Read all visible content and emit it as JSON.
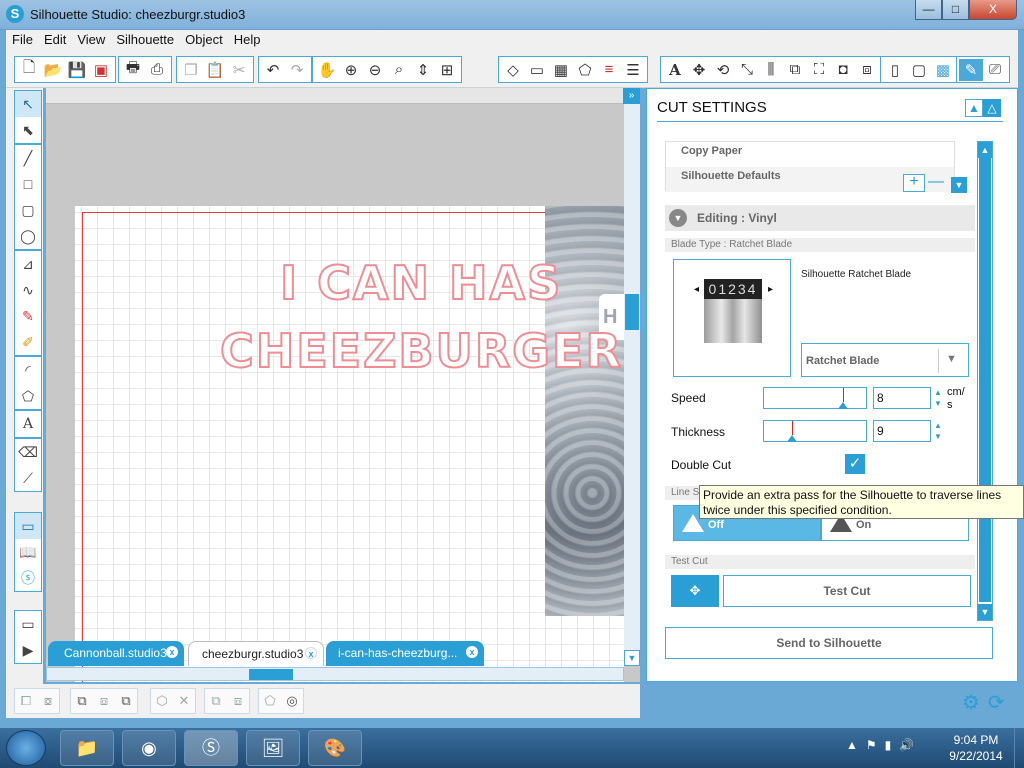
{
  "window": {
    "title": "Silhouette Studio: cheezburgr.studio3",
    "logo": "S",
    "min": "—",
    "max": "□",
    "close": "X"
  },
  "menu": [
    "File",
    "Edit",
    "View",
    "Silhouette",
    "Object",
    "Help"
  ],
  "toolbar": {
    "file_icons": [
      "new-document-icon",
      "open-icon",
      "save-icon",
      "save-library-icon"
    ],
    "print_icons": [
      "print-icon",
      "print-cut-icon"
    ],
    "clipboard_icons": [
      "copy-icon",
      "paste-icon",
      "cut-icon"
    ],
    "history_icons": [
      "undo-icon",
      "redo-icon"
    ],
    "view_icons": [
      "pan-hand-icon",
      "zoom-in-icon",
      "zoom-out-icon",
      "zoom-select-icon",
      "zoom-drag-icon",
      "fit-page-icon"
    ],
    "panel_icons": [
      "fill-icon",
      "page-setup-icon",
      "fill-pattern-icon",
      "line-color-icon",
      "line-style-icon",
      "align-lines-icon",
      "text-style-icon",
      "transform-icon",
      "rotate-icon",
      "scale-icon",
      "align-icon",
      "replicate-icon",
      "trace-icon",
      "offset-icon",
      "cut-style-icon",
      "design-store-icon",
      "library-icon",
      "grid-icon"
    ],
    "right_icons": [
      "cut-settings-icon",
      "send-icon"
    ]
  },
  "left_tools": [
    "select-icon",
    "edit-points-icon",
    "line-icon",
    "rectangle-icon",
    "rounded-rect-icon",
    "ellipse-icon",
    "polygon-icon",
    "curve-icon",
    "freehand-icon",
    "smooth-freehand-icon",
    "arc-icon",
    "regular-polygon-icon",
    "text-icon",
    "eraser-icon",
    "knife-icon",
    "design-page-icon",
    "library-view-icon",
    "store-icon",
    "preview-icon",
    "expand-icon"
  ],
  "canvas": {
    "design_line1": "I CAN HAS",
    "design_line2": "CHEEZBURGER?",
    "photo_tab_text": "H"
  },
  "tabs": [
    {
      "label": "Cannonball.studio3",
      "close": "x"
    },
    {
      "label": "cheezburgr.studio3",
      "close": "x"
    },
    {
      "label": "i-can-has-cheezburg...",
      "close": "x"
    }
  ],
  "panel": {
    "title": "CUT SETTINGS",
    "materials": [
      "Copy Paper",
      "Silhouette Defaults"
    ],
    "plus": "+",
    "minus": "—",
    "editing_label": "Editing : Vinyl",
    "blade_section": "Blade Type : Ratchet Blade",
    "blade_numbers": "01234",
    "blade_name": "Silhouette Ratchet Blade",
    "blade_select": "Ratchet Blade",
    "speed_label": "Speed",
    "speed_value": "8",
    "speed_fraction": 0.76,
    "speed_unit": "cm/\ns",
    "thickness_label": "Thickness",
    "thickness_value": "9",
    "thickness_fraction": 0.27,
    "double_cut_label": "Double Cut",
    "double_cut_checked": true,
    "line_section": "Line S",
    "line_off": "Off",
    "line_on": "On",
    "test_section": "Test Cut",
    "test_cut": "Test Cut",
    "send": "Send to Silhouette"
  },
  "tooltip": "Provide an extra pass for the Silhouette to traverse lines twice under this specified condition.",
  "taskbar": {
    "apps": [
      "file-explorer-icon",
      "chrome-icon",
      "silhouette-studio-icon",
      "photos-icon",
      "paint-icon"
    ],
    "time": "9:04 PM",
    "date": "9/22/2014"
  },
  "colors": {
    "accent": "#2a9fd6",
    "design_outline": "#ef8d93",
    "cut_line": "#e23b3b"
  }
}
